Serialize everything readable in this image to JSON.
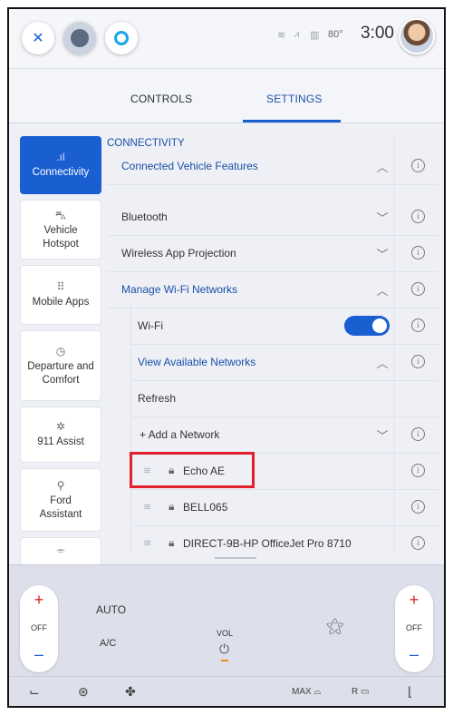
{
  "status_bar": {
    "temperature": "80°",
    "clock": "3:00",
    "close_icon": "close-icon",
    "assistant_icon": "alexa-ring-icon"
  },
  "tabs": [
    {
      "label": "CONTROLS",
      "active": false
    },
    {
      "label": "SETTINGS",
      "active": true
    }
  ],
  "sidebar": {
    "items": [
      {
        "label": "Connectivity",
        "icon": "signal-icon",
        "active": true
      },
      {
        "label": "Vehicle Hotspot",
        "icon": "car-hotspot-icon",
        "active": false
      },
      {
        "label": "Mobile Apps",
        "icon": "apps-grid-icon",
        "active": false
      },
      {
        "label": "Departure and Comfort",
        "icon": "clock-icon",
        "active": false
      },
      {
        "label": "911 Assist",
        "icon": "assist-icon",
        "active": false
      },
      {
        "label": "Ford Assistant",
        "icon": "person-icon",
        "active": false
      }
    ]
  },
  "main": {
    "section_title": "CONNECTIVITY",
    "rows": {
      "connected_vehicle_features": "Connected Vehicle Features",
      "bluetooth": "Bluetooth",
      "wireless_app_projection": "Wireless App Projection",
      "manage_wifi": "Manage Wi-Fi Networks",
      "wifi": "Wi-Fi",
      "view_available": "View Available Networks",
      "refresh": "Refresh",
      "add_network": "+ Add a Network"
    },
    "wifi_enabled": true,
    "networks": [
      {
        "name": "Echo AE",
        "locked": true,
        "highlighted": true
      },
      {
        "name": "BELL065",
        "locked": true,
        "highlighted": false
      },
      {
        "name": "DIRECT-9B-HP OfficeJet Pro 8710",
        "locked": true,
        "highlighted": false
      }
    ]
  },
  "climate": {
    "left_off": "OFF",
    "right_off": "OFF",
    "auto": "AUTO",
    "ac": "A/C",
    "vol": "VOL",
    "max": "MAX",
    "rear": "R",
    "plus": "+",
    "minus": "–"
  },
  "colors": {
    "accent": "#1a5fd1",
    "highlight_box": "#e0202a"
  }
}
